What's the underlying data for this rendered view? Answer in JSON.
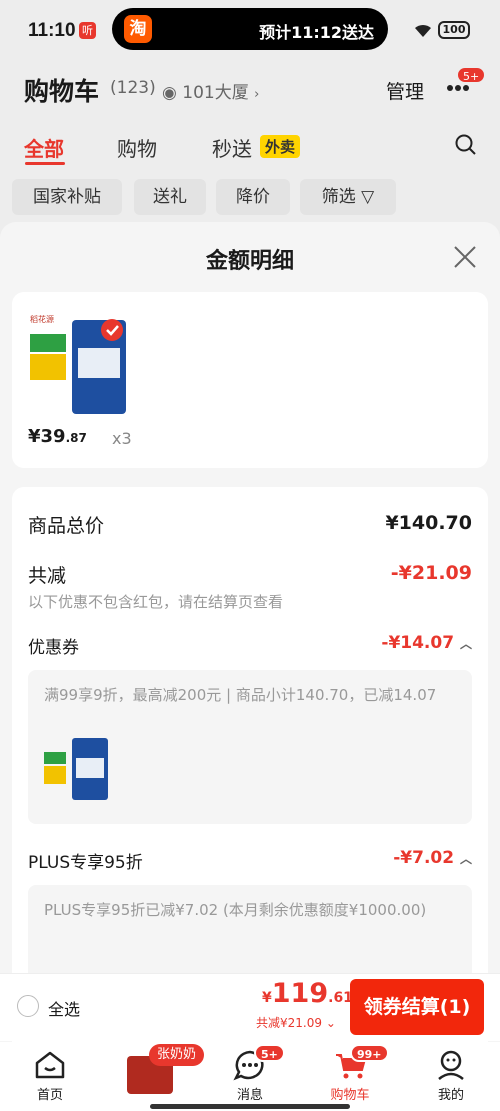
{
  "status": {
    "time": "11:10",
    "time_badge": "听",
    "island_app": "淘",
    "island_text": "预计11:12送达",
    "battery": "100"
  },
  "header": {
    "title": "购物车",
    "count": "(123)",
    "address": "101大厦",
    "manage": "管理",
    "more_badge": "5+"
  },
  "tabs": [
    {
      "label": "全部"
    },
    {
      "label": "购物"
    },
    {
      "label": "秒送"
    }
  ],
  "flash_tag": "外卖",
  "chips": [
    "国家补贴",
    "送礼",
    "降价",
    "筛选"
  ],
  "sheet": {
    "title": "金额明细",
    "product": {
      "brand": "稻花源",
      "price_int": "¥39",
      "price_dec": ".87",
      "qty": "x3"
    },
    "total_label": "商品总价",
    "total_value": "¥140.70",
    "reduce_label": "共减",
    "reduce_value": "-¥21.09",
    "reduce_note": "以下优惠不包含红包，请在结算页查看",
    "coupon_label": "优惠券",
    "coupon_value": "-¥14.07",
    "coupon_detail": "满99享9折，最高减200元 | 商品小计140.70，已减14.07",
    "plus_label": "PLUS专享95折",
    "plus_value": "-¥7.02",
    "plus_detail": "PLUS专享95折已减¥7.02 (本月剩余优惠额度¥1000.00)"
  },
  "checkout": {
    "select_all": "全选",
    "yen": "¥",
    "total_int": "119",
    "total_dec": ".61",
    "discount": "共减¥21.09",
    "pay": "领券结算(1)"
  },
  "nav": {
    "home": "首页",
    "promo_badge": "张奶奶",
    "msg": "消息",
    "msg_badge": "5+",
    "cart": "购物车",
    "cart_badge": "99+",
    "me": "我的"
  },
  "colors": {
    "accent": "#e8372d",
    "brand_orange": "#ff5a00"
  }
}
